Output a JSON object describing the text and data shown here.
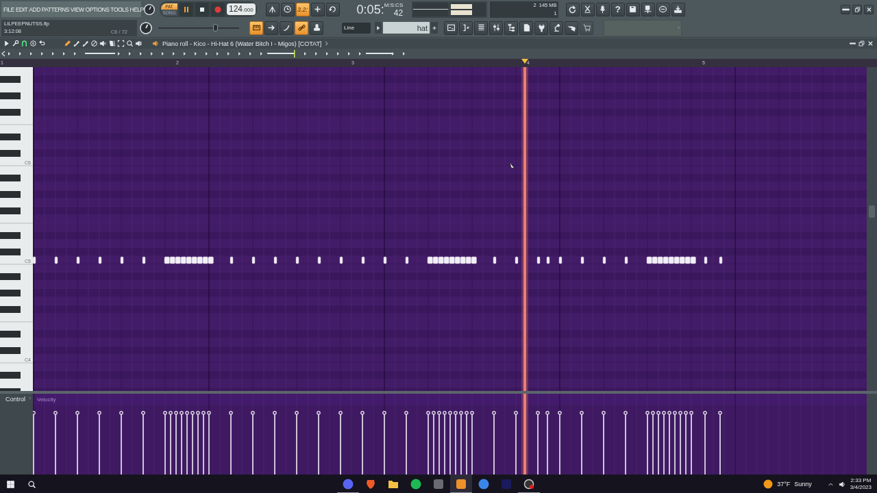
{
  "menu": [
    "FILE",
    "EDIT",
    "ADD",
    "PATTERNS",
    "VIEW",
    "OPTIONS",
    "TOOLS",
    "HELP"
  ],
  "hint_panel": {
    "file": "LILPEEPNUTSS.flp",
    "time": "3:12:08",
    "note": "C6 / 72"
  },
  "transport": {
    "modes": [
      {
        "label": "PAT",
        "selected": true
      },
      {
        "label": "SONG",
        "selected": false
      }
    ]
  },
  "tempo": {
    "whole": "124",
    "fraction": ".000"
  },
  "time_display": {
    "main": "0:05:",
    "small": "42",
    "unit": "M:S:CS"
  },
  "cpu": {
    "value": "2",
    "memory": "145 MB",
    "polyphony": "1"
  },
  "toggles_row1": [
    {
      "on": false
    },
    {
      "on": false
    },
    {
      "on": true,
      "label": "3.2:"
    },
    {
      "on": false
    },
    {
      "on": false
    }
  ],
  "main_volume": {
    "level": 0.72
  },
  "toggles_row2": [
    {
      "on": true
    },
    {
      "on": false
    },
    {
      "on": false
    },
    {
      "on": true
    },
    {
      "on": false
    }
  ],
  "help_button": "?",
  "snap": "Line",
  "browser_search": "hat",
  "piano_roll": {
    "title": "Piano roll - Kico - Hi-Hat 6 (Water Bitch I - Migos) [COTAT]",
    "bar_numbers": [
      "1",
      "2",
      "3",
      "4",
      "5"
    ],
    "key_labels": [
      "C6",
      "C5",
      "C4"
    ],
    "control_label": "Control",
    "control_target": "Velocity"
  },
  "taskbar": {
    "apps": [
      {
        "running": true,
        "selected": false
      },
      {
        "running": false,
        "selected": false
      },
      {
        "running": false,
        "selected": false
      },
      {
        "running": false,
        "selected": false
      },
      {
        "running": false,
        "selected": false
      },
      {
        "running": true,
        "selected": true
      },
      {
        "running": false,
        "selected": false
      },
      {
        "running": false,
        "selected": false
      },
      {
        "running": true,
        "selected": false
      }
    ],
    "weather": {
      "temp": "37°F",
      "condition": "Sunny"
    },
    "clock": {
      "time": "2:33 PM",
      "date": "3/4/2023"
    }
  }
}
